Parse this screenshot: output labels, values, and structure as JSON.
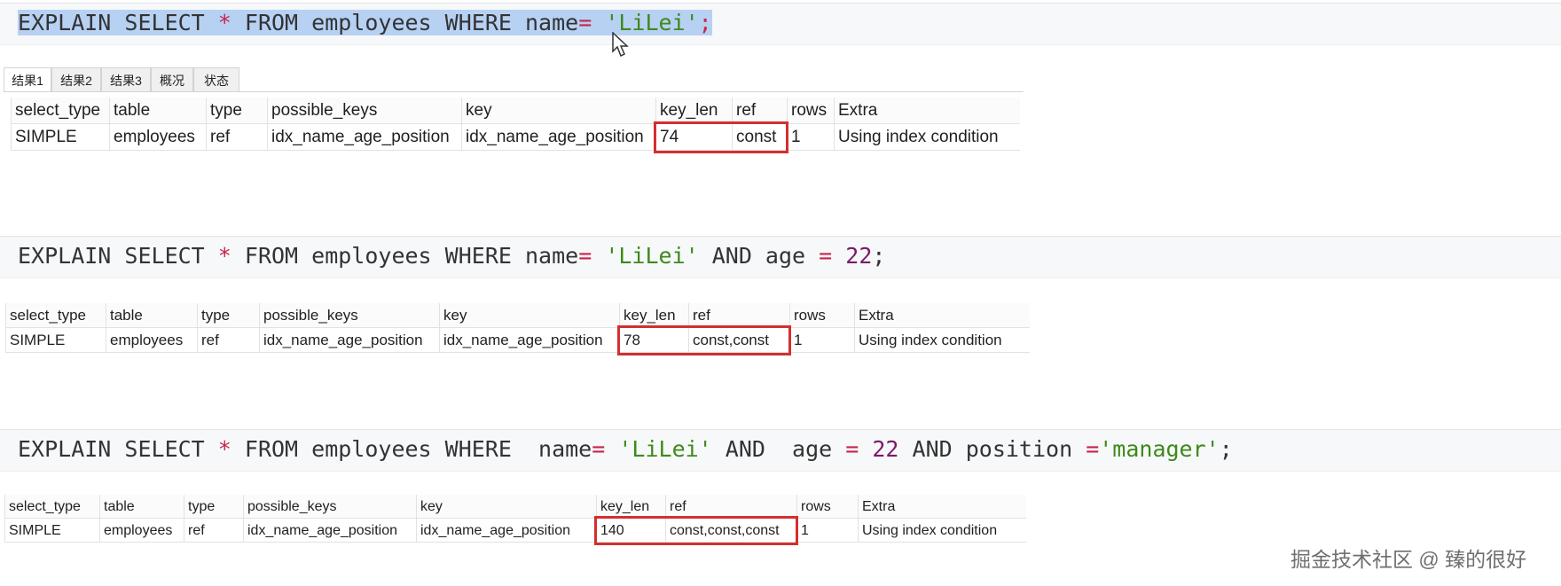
{
  "queries": [
    {
      "tokens": [
        {
          "t": "EXPLAIN SELECT ",
          "c": "kw"
        },
        {
          "t": "*",
          "c": "op"
        },
        {
          "t": " FROM employees WHERE name",
          "c": "kw"
        },
        {
          "t": "=",
          "c": "op"
        },
        {
          "t": " ",
          "c": "kw"
        },
        {
          "t": "'LiLei'",
          "c": "str"
        },
        {
          "t": ";",
          "c": "op"
        }
      ],
      "selected": true,
      "show_tabs": true,
      "columns": [
        "select_type",
        "table",
        "type",
        "possible_keys",
        "key",
        "key_len",
        "ref",
        "rows",
        "Extra"
      ],
      "rows": [
        [
          "SIMPLE",
          "employees",
          "ref",
          "idx_name_age_position",
          "idx_name_age_position",
          "74",
          "const",
          "1",
          "Using index condition"
        ]
      ]
    },
    {
      "tokens": [
        {
          "t": "EXPLAIN SELECT ",
          "c": "kw"
        },
        {
          "t": "*",
          "c": "op"
        },
        {
          "t": " FROM employees WHERE name",
          "c": "kw"
        },
        {
          "t": "=",
          "c": "op"
        },
        {
          "t": " ",
          "c": "kw"
        },
        {
          "t": "'LiLei'",
          "c": "str"
        },
        {
          "t": " AND age ",
          "c": "kw"
        },
        {
          "t": "=",
          "c": "op"
        },
        {
          "t": " ",
          "c": "kw"
        },
        {
          "t": "22",
          "c": "num"
        },
        {
          "t": ";",
          "c": "kw"
        }
      ],
      "selected": false,
      "show_tabs": false,
      "columns": [
        "select_type",
        "table",
        "type",
        "possible_keys",
        "key",
        "key_len",
        "ref",
        "rows",
        "Extra"
      ],
      "rows": [
        [
          "SIMPLE",
          "employees",
          "ref",
          "idx_name_age_position",
          "idx_name_age_position",
          "78",
          "const,const",
          "1",
          "Using index condition"
        ]
      ]
    },
    {
      "tokens": [
        {
          "t": "EXPLAIN SELECT ",
          "c": "kw"
        },
        {
          "t": "*",
          "c": "op"
        },
        {
          "t": " FROM employees WHERE  name",
          "c": "kw"
        },
        {
          "t": "=",
          "c": "op"
        },
        {
          "t": " ",
          "c": "kw"
        },
        {
          "t": "'LiLei'",
          "c": "str"
        },
        {
          "t": " AND  age ",
          "c": "kw"
        },
        {
          "t": "=",
          "c": "op"
        },
        {
          "t": " ",
          "c": "kw"
        },
        {
          "t": "22",
          "c": "num"
        },
        {
          "t": " AND position ",
          "c": "kw"
        },
        {
          "t": "=",
          "c": "op"
        },
        {
          "t": "'manager'",
          "c": "str"
        },
        {
          "t": ";",
          "c": "kw"
        }
      ],
      "selected": false,
      "show_tabs": false,
      "columns": [
        "select_type",
        "table",
        "type",
        "possible_keys",
        "key",
        "key_len",
        "ref",
        "rows",
        "Extra"
      ],
      "rows": [
        [
          "SIMPLE",
          "employees",
          "ref",
          "idx_name_age_position",
          "idx_name_age_position",
          "140",
          "const,const,const",
          "1",
          "Using index condition"
        ]
      ]
    }
  ],
  "result_tabs": [
    "结果1",
    "结果2",
    "结果3",
    "概况",
    "状态"
  ],
  "active_tab": "结果1",
  "highlighted_columns": [
    "key_len",
    "ref"
  ],
  "watermark": "掘金技术社区 @ 臻的很好",
  "colors": {
    "selection": "#b7d1f3",
    "string": "#3d8a1a",
    "number": "#7a1a6a",
    "operator": "#c7254e",
    "highlight_box": "#d32f2f"
  }
}
